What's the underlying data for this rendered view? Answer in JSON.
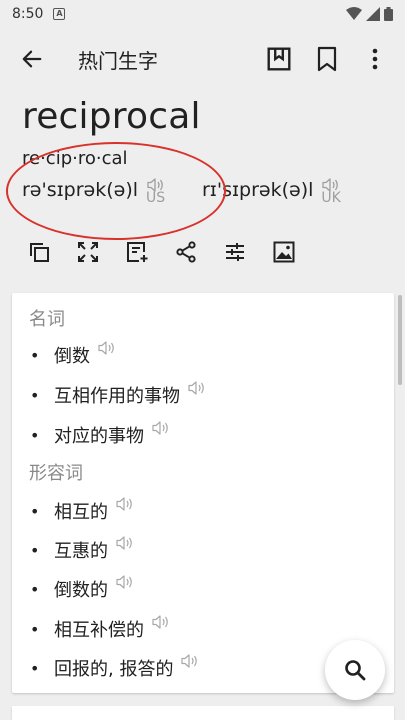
{
  "status": {
    "time": "8:50",
    "notif_glyph": "A"
  },
  "appbar": {
    "title": "热门生字"
  },
  "word": {
    "headword": "reciprocal",
    "syllables": "re·cip·ro·cal",
    "us": {
      "ipa": "rə'sɪprək(ə)l",
      "region": "US"
    },
    "uk": {
      "ipa": "rɪ'sɪprək(ə)l",
      "region": "UK"
    }
  },
  "definitions": {
    "noun": {
      "label": "名词",
      "senses": [
        "倒数",
        "互相作用的事物",
        "对应的事物"
      ]
    },
    "adj": {
      "label": "形容词",
      "senses": [
        "相互的",
        "互惠的",
        "倒数的",
        "相互补偿的",
        "回报的, 报答的"
      ]
    }
  },
  "bullet": "•",
  "colors": {
    "annotation": "#d9312b",
    "pos_label": "#8a8a8a",
    "background": "#eeeeee"
  }
}
